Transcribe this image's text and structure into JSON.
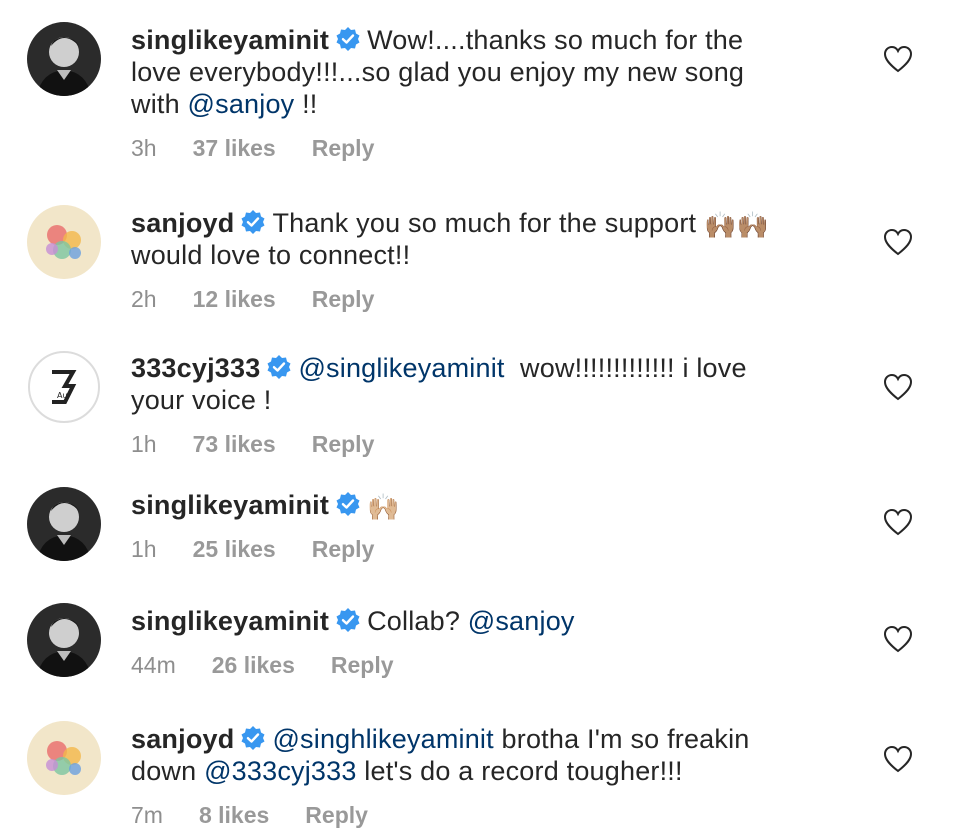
{
  "colors": {
    "mention": "#003569",
    "meta": "#8e8e8e",
    "verified": "#3897f0",
    "text": "#262626"
  },
  "comments": [
    {
      "username": "singlikeyaminit",
      "avatar": "profile-photo-man",
      "verified": true,
      "parts": [
        {
          "type": "text",
          "value": "Wow!....thanks so much for the"
        },
        {
          "type": "br"
        },
        {
          "type": "text",
          "value": "love everybody!!!...so glad you enjoy my new song"
        },
        {
          "type": "br"
        },
        {
          "type": "text",
          "value": "with "
        },
        {
          "type": "mention",
          "value": "@sanjoy"
        },
        {
          "type": "text",
          "value": " !!"
        }
      ],
      "time": "3h",
      "likes": "37 likes",
      "reply": "Reply"
    },
    {
      "username": "sanjoyd",
      "avatar": "colorful-art-avatar",
      "verified": true,
      "parts": [
        {
          "type": "text",
          "value": "Thank you so much for the support "
        },
        {
          "type": "emoji",
          "value": "🙌🏽🙌🏽"
        },
        {
          "type": "br"
        },
        {
          "type": "text",
          "value": "would love to connect!!"
        }
      ],
      "time": "2h",
      "likes": "12 likes",
      "reply": "Reply"
    },
    {
      "username": "333cyj333",
      "avatar": "number-3-logo-avatar",
      "verified": true,
      "parts": [
        {
          "type": "mention",
          "value": "@singlikeyaminit"
        },
        {
          "type": "text",
          "value": "  wow!!!!!!!!!!!!! i love"
        },
        {
          "type": "br"
        },
        {
          "type": "text",
          "value": "your voice !"
        }
      ],
      "time": "1h",
      "likes": "73 likes",
      "reply": "Reply"
    },
    {
      "username": "singlikeyaminit",
      "avatar": "profile-photo-man",
      "verified": true,
      "parts": [
        {
          "type": "emoji",
          "value": "🙌🏼"
        }
      ],
      "time": "1h",
      "likes": "25 likes",
      "reply": "Reply"
    },
    {
      "username": "singlikeyaminit",
      "avatar": "profile-photo-man",
      "verified": true,
      "parts": [
        {
          "type": "text",
          "value": "Collab? "
        },
        {
          "type": "mention",
          "value": "@sanjoy"
        }
      ],
      "time": "44m",
      "likes": "26 likes",
      "reply": "Reply"
    },
    {
      "username": "sanjoyd",
      "avatar": "colorful-art-avatar",
      "verified": true,
      "parts": [
        {
          "type": "mention",
          "value": "@singhlikeyaminit"
        },
        {
          "type": "text",
          "value": " brotha I'm so freakin"
        },
        {
          "type": "br"
        },
        {
          "type": "text",
          "value": "down "
        },
        {
          "type": "mention",
          "value": "@333cyj333"
        },
        {
          "type": "text",
          "value": " let's do a record tougher!!!"
        }
      ],
      "time": "7m",
      "likes": "8 likes",
      "reply": "Reply"
    }
  ]
}
